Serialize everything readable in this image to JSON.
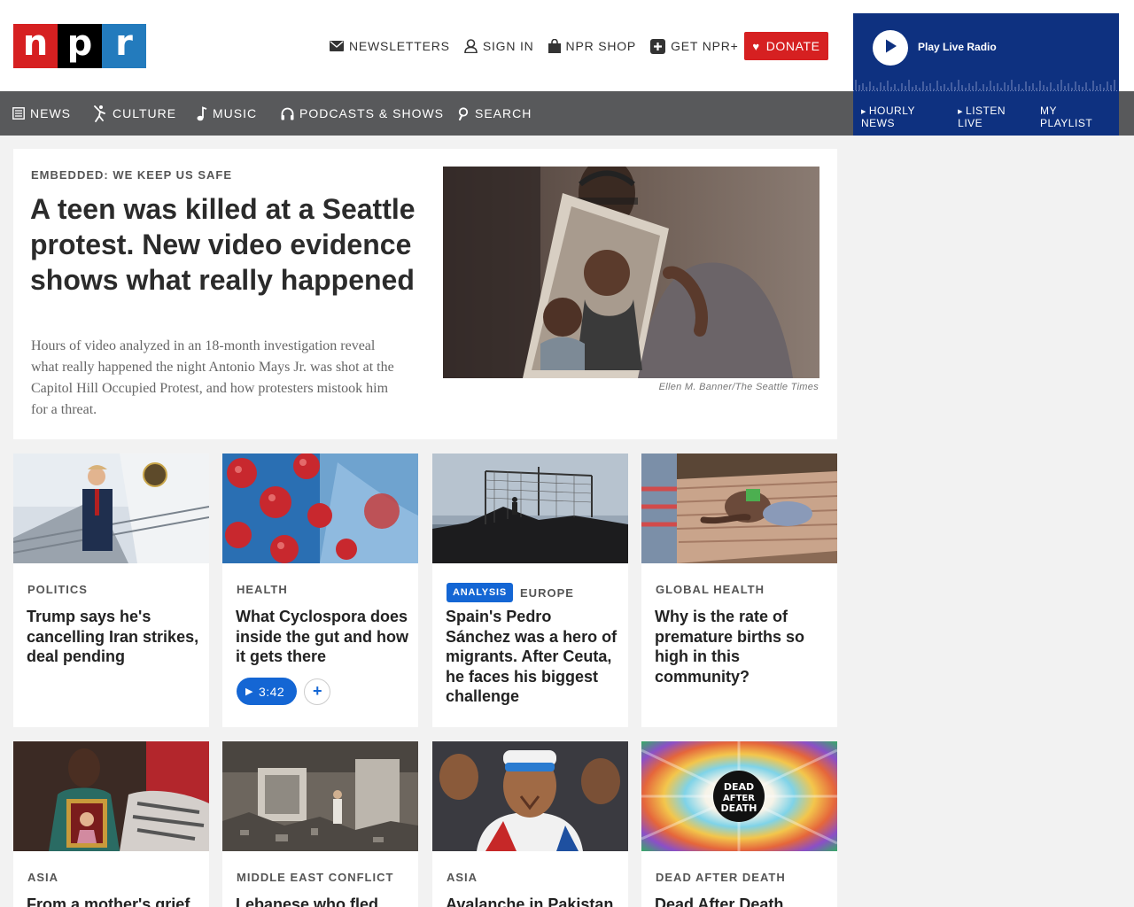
{
  "header": {
    "logo": [
      "n",
      "p",
      "r"
    ],
    "utility": [
      {
        "label": "NEWSLETTERS",
        "icon": "envelope-icon"
      },
      {
        "label": "SIGN IN",
        "icon": "user-icon"
      },
      {
        "label": "NPR SHOP",
        "icon": "shopping-bag-icon"
      },
      {
        "label": "GET NPR+",
        "icon": "plus-square-icon"
      }
    ],
    "donate_label": "DONATE",
    "colors": {
      "donate": "#d62021",
      "nav": "#58595b",
      "player": "#0e3180",
      "accent": "#1466d4"
    }
  },
  "nav": [
    {
      "label": "NEWS",
      "icon": "newspaper-icon"
    },
    {
      "label": "CULTURE",
      "icon": "dancer-icon"
    },
    {
      "label": "MUSIC",
      "icon": "music-note-icon"
    },
    {
      "label": "PODCASTS & SHOWS",
      "icon": "headphones-icon"
    },
    {
      "label": "SEARCH",
      "icon": "search-icon"
    }
  ],
  "player": {
    "play_label": "Play Live Radio",
    "links": [
      "HOURLY NEWS",
      "LISTEN LIVE",
      "MY PLAYLIST"
    ]
  },
  "feature": {
    "slug": "EMBEDDED: WE KEEP US SAFE",
    "headline": "A teen was killed at a Seattle protest. New video evidence shows what really happened",
    "teaser": "Hours of video analyzed in an 18-month investigation reveal what really happened the night Antonio Mays Jr. was shot at the Capitol Hill Occupied Protest, and how protesters mistook him for a threat.",
    "credit": "Ellen M. Banner/The Seattle Times"
  },
  "cards": [
    {
      "tag": "POLITICS",
      "headline": "Trump says he's cancelling Iran strikes, deal pending"
    },
    {
      "tag": "HEALTH",
      "headline": "What Cyclospora does inside the gut and how it gets there",
      "audio": "3:42",
      "add": "+"
    },
    {
      "pill": "ANALYSIS",
      "tag": "EUROPE",
      "headline": "Spain's Pedro Sánchez was a hero of migrants. After Ceuta, he faces his biggest challenge"
    },
    {
      "tag": "GLOBAL HEALTH",
      "headline": "Why is the rate of premature births so high in this community?"
    },
    {
      "tag": "ASIA",
      "headline": "From a mother's grief"
    },
    {
      "tag": "MIDDLE EAST CONFLICT",
      "headline": "Lebanese who fled"
    },
    {
      "tag": "ASIA",
      "headline": "Avalanche in Pakistan"
    },
    {
      "tag": "DEAD AFTER DEATH",
      "headline": "Dead After Death",
      "logo_text": [
        "DEAD",
        "AFTER",
        "DEATH"
      ]
    }
  ]
}
